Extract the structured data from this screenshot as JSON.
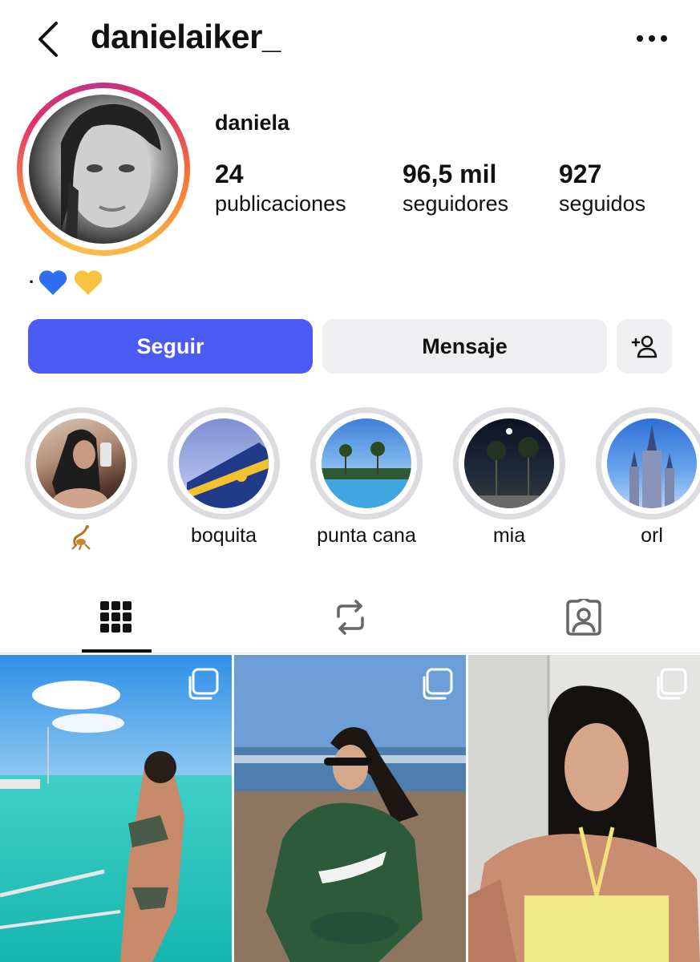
{
  "header": {
    "username": "danielaiker_",
    "back_icon": "chevron-left-icon",
    "more_icon": "more-horizontal-icon"
  },
  "profile": {
    "full_name": "daniela",
    "stats": [
      {
        "value": "24",
        "label": "publicaciones"
      },
      {
        "value": "96,5 mil",
        "label": "seguidores"
      },
      {
        "value": "927",
        "label": "seguidos"
      }
    ],
    "bio": {
      "dot": "·",
      "emojis": [
        "blue-heart-icon",
        "yellow-heart-icon"
      ]
    }
  },
  "actions": {
    "follow_label": "Seguir",
    "message_label": "Mensaje",
    "add_user_icon": "add-user-icon"
  },
  "highlights": [
    {
      "label": "",
      "icon": "scorpion-icon"
    },
    {
      "label": "boquita"
    },
    {
      "label": "punta cana"
    },
    {
      "label": "mia"
    },
    {
      "label": "orl"
    }
  ],
  "tabs": [
    {
      "icon": "grid-icon",
      "active": true
    },
    {
      "icon": "reposts-icon",
      "active": false
    },
    {
      "icon": "tagged-icon",
      "active": false
    }
  ],
  "posts": [
    {
      "type": "carousel"
    },
    {
      "type": "carousel"
    },
    {
      "type": "carousel"
    }
  ],
  "colors": {
    "follow_button": "#4b5cf5",
    "secondary_button": "#efeff2",
    "highlight_ring": "#dcdce0",
    "story_ring_gradient": [
      "#fdc04f",
      "#f77737",
      "#e1306c",
      "#c13584"
    ]
  }
}
